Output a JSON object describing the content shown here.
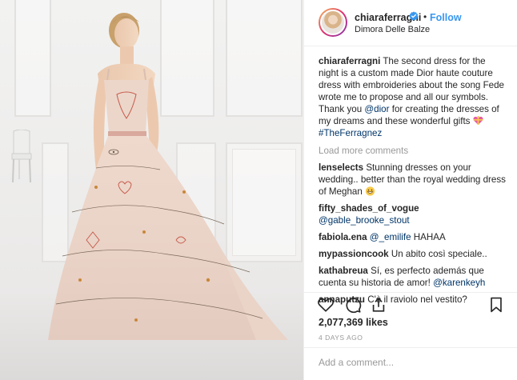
{
  "post": {
    "username": "chiaraferragni",
    "dot": "•",
    "follow_label": "Follow",
    "location": "Dimora Delle Balze",
    "photo_icon": "wedding-dress-photo",
    "caption": {
      "username": "chiaraferragni",
      "text": "The second dress for the night is a custom made Dior haute couture dress with embroideries about the song Fede wrote me to propose and all our symbols. Thank you",
      "mention": "@dior",
      "text2": "for creating the dresses of my dreams and these wonderful gifts",
      "emoji": "heart-ribbon-emoji",
      "hashtag": "#TheFerragnez"
    },
    "load_more_label": "Load more comments",
    "comments": [
      {
        "username": "lenselects",
        "text": "Stunning dresses on your wedding.. better than the royal wedding dress of Meghan",
        "emoji": "grin-emoji"
      },
      {
        "username": "fifty_shades_of_vogue",
        "text": "",
        "mention": "@gable_brooke_stout"
      },
      {
        "username": "fabiola.ena",
        "text": "HAHAA",
        "mention": "@_emilife"
      },
      {
        "username": "mypassioncook",
        "text": "Un abito così speciale.."
      },
      {
        "username": "kathabreua",
        "text": "Sí, es perfecto además que cuenta su historia de amor!",
        "mention": "@karenkeyh"
      },
      {
        "username": "annaputzu",
        "text": "C'è il raviolo nel vestito?"
      }
    ],
    "likes": "2,077,369 likes",
    "time": "4 DAYS AGO",
    "add_comment_placeholder": "Add a comment...",
    "icons": {
      "like": "heart-icon",
      "comment": "comment-bubble-icon",
      "share": "share-arrow-icon",
      "save": "bookmark-icon",
      "verified": "verified-badge-icon"
    },
    "colors": {
      "link": "#003569",
      "follow": "#3897f0",
      "verified": "#3897f0",
      "muted": "#999999"
    }
  }
}
